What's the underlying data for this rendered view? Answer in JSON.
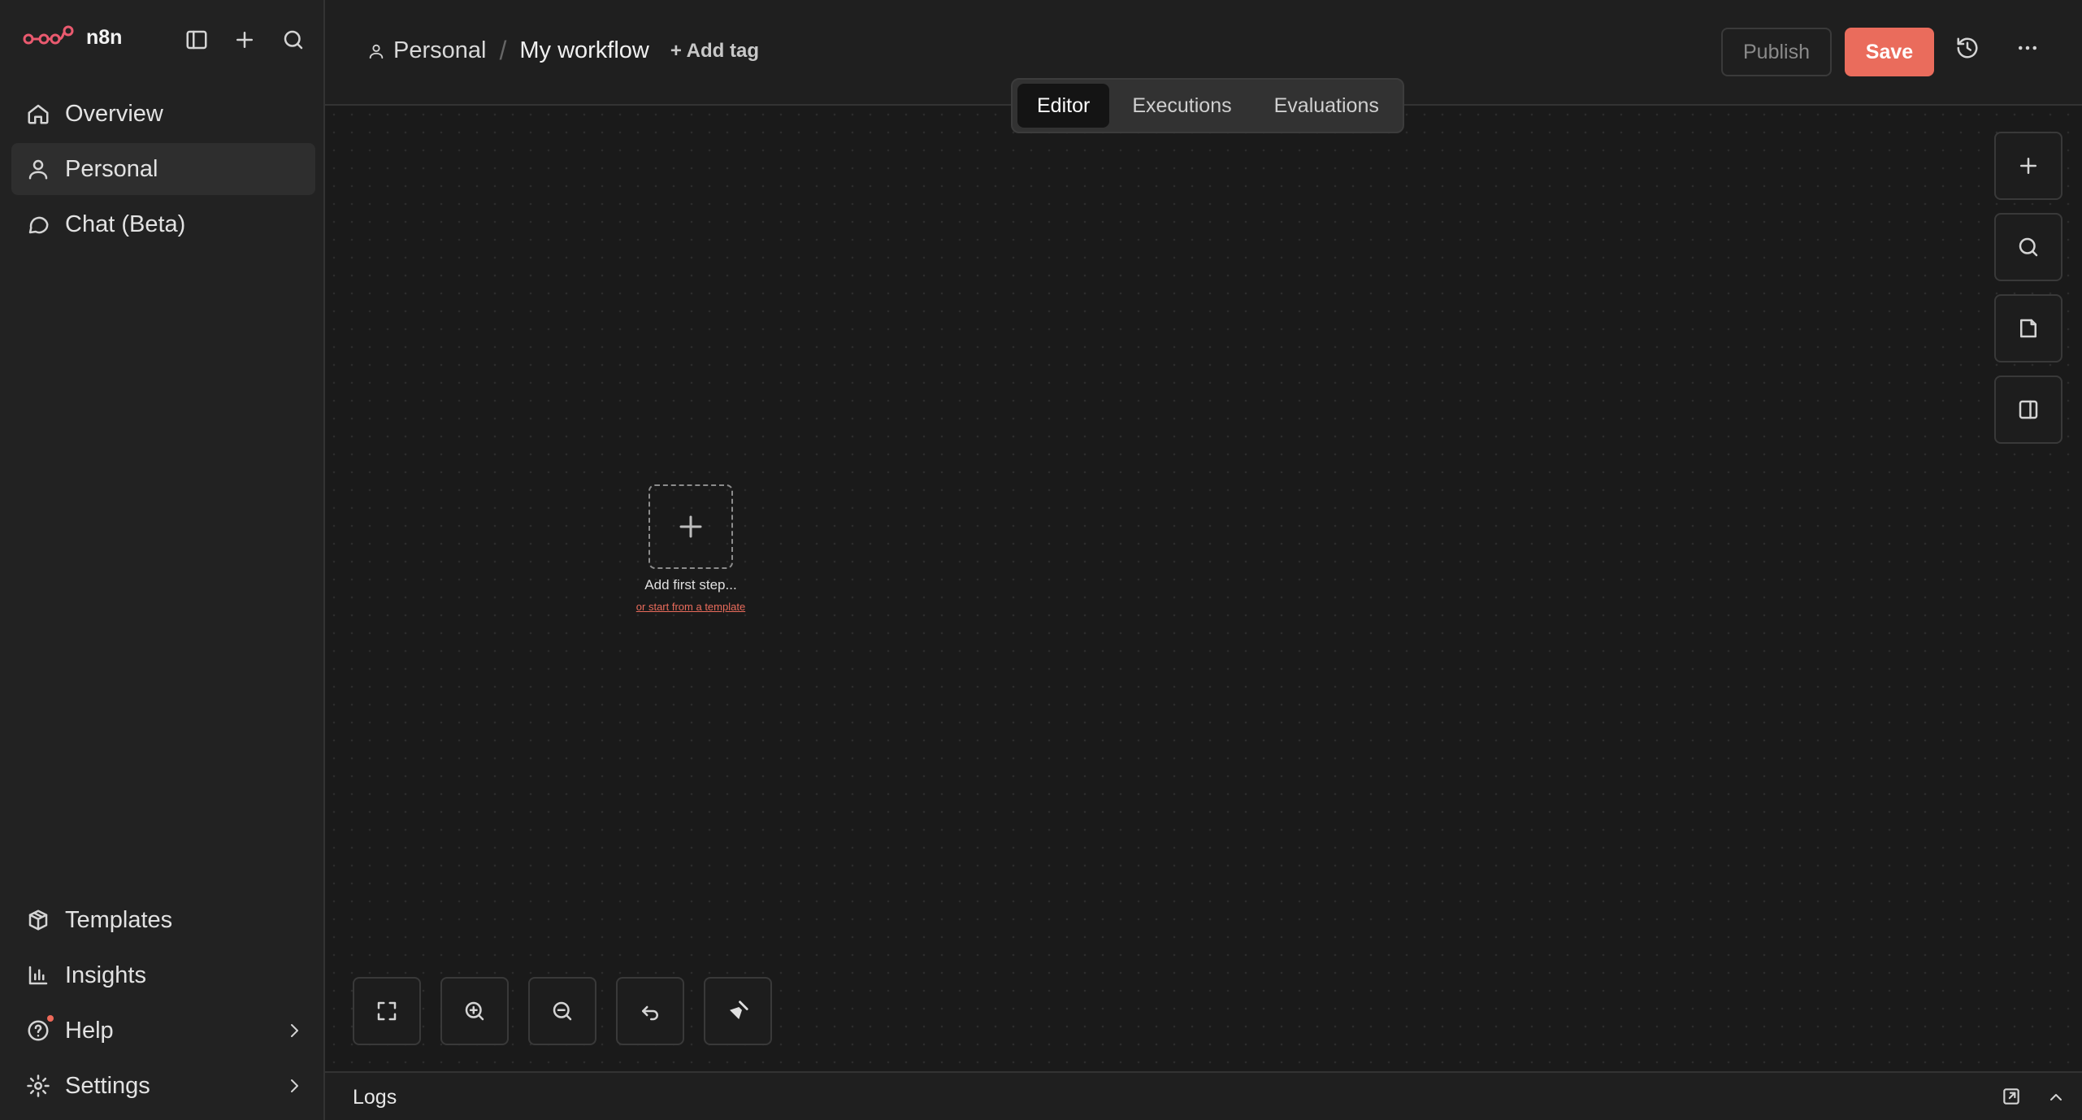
{
  "brand": {
    "name": "n8n"
  },
  "sidebar": {
    "top_items": [
      {
        "label": "Overview",
        "icon": "home-icon"
      },
      {
        "label": "Personal",
        "icon": "user-icon",
        "active": true
      },
      {
        "label": "Chat (Beta)",
        "icon": "chat-bubble-icon"
      }
    ],
    "bottom_items": [
      {
        "label": "Templates",
        "icon": "templates-box-icon"
      },
      {
        "label": "Insights",
        "icon": "bar-chart-icon"
      },
      {
        "label": "Help",
        "icon": "help-circle-icon",
        "has_notification": true
      },
      {
        "label": "Settings",
        "icon": "gear-icon"
      }
    ]
  },
  "header": {
    "breadcrumb_project": "Personal",
    "breadcrumb_separator": "/",
    "workflow_name": "My workflow",
    "add_tag": "+ Add tag",
    "publish_label": "Publish",
    "save_label": "Save"
  },
  "tabs": [
    {
      "label": "Editor",
      "active": true
    },
    {
      "label": "Executions"
    },
    {
      "label": "Evaluations"
    }
  ],
  "canvas": {
    "add_first_step": "Add first step...",
    "template_link": "or start from a template"
  },
  "logs": {
    "label": "Logs"
  },
  "colors": {
    "accent": "#ea6c5c",
    "background": "#1a1a1a",
    "sidebar": "#222222"
  }
}
